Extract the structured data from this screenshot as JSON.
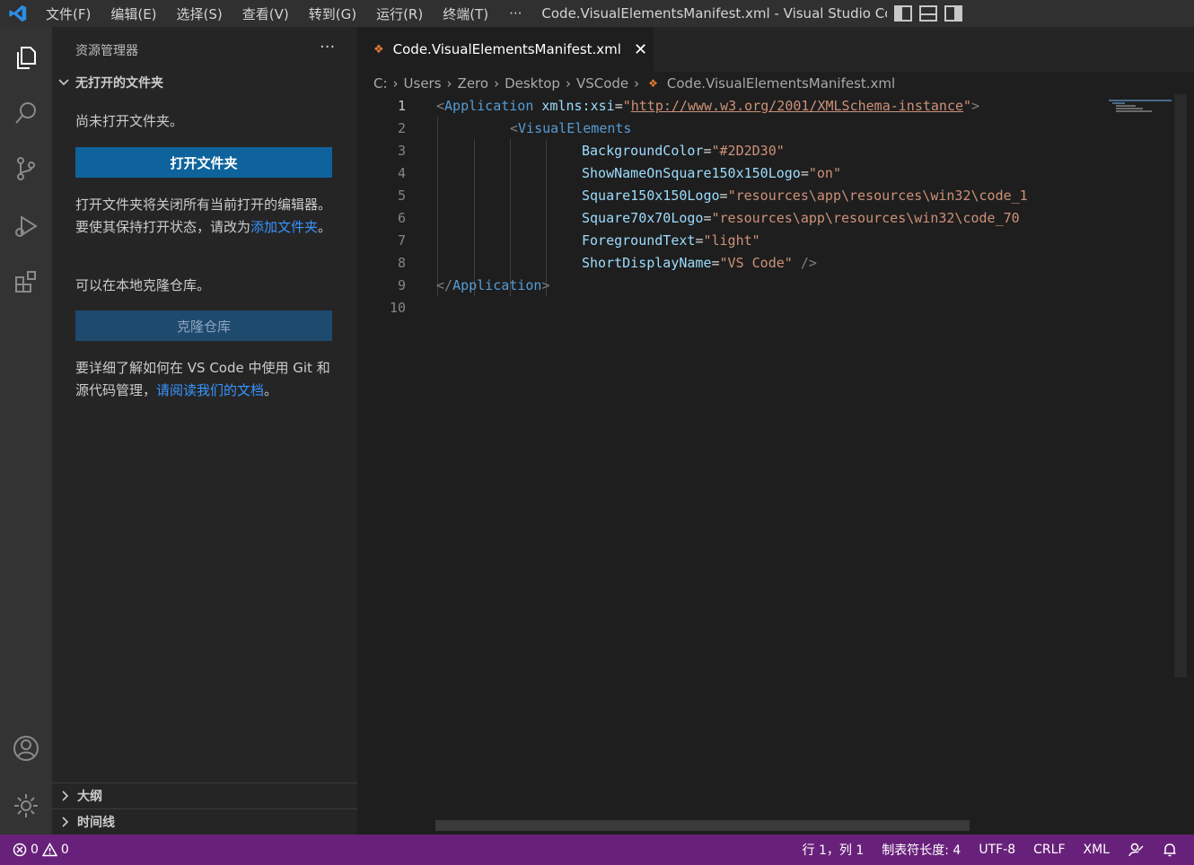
{
  "titlebar": {
    "menus": [
      "文件(F)",
      "编辑(E)",
      "选择(S)",
      "查看(V)",
      "转到(G)",
      "运行(R)",
      "终端(T)"
    ],
    "more": "···",
    "window_title": "Code.VisualElementsManifest.xml - Visual Studio Cod..."
  },
  "sidebar": {
    "header": "资源管理器",
    "header_more": "···",
    "section_title": "无打开的文件夹",
    "no_folder_text": "尚未打开文件夹。",
    "open_folder_button": "打开文件夹",
    "open_folder_note_1": "打开文件夹将关闭所有当前打开的编辑器。要使其保持打开状态，请改为",
    "open_folder_note_link": "添加文件夹",
    "open_folder_note_end": "。",
    "clone_text": "可以在本地克隆仓库。",
    "clone_button": "克隆仓库",
    "learn_text": "要详细了解如何在 VS Code 中使用 Git 和源代码管理，",
    "learn_link": "请阅读我们的文档",
    "learn_end": "。",
    "outline": "大纲",
    "timeline": "时间线"
  },
  "editor": {
    "tab_label": "Code.VisualElementsManifest.xml",
    "breadcrumb": [
      "C:",
      "Users",
      "Zero",
      "Desktop",
      "VSCode",
      "Code.VisualElementsManifest.xml"
    ],
    "line_numbers": [
      "1",
      "2",
      "3",
      "4",
      "5",
      "6",
      "7",
      "8",
      "9",
      "10"
    ],
    "line1": {
      "open": "<",
      "tag": "Application",
      "attr": "xmlns:xsi",
      "eq": "=",
      "q1": "\"",
      "url": "http://www.w3.org/2001/XMLSchema-instance",
      "q2": "\"",
      "close": ">"
    },
    "line2": {
      "open": "<",
      "tag": "VisualElements"
    },
    "line3": {
      "attr": "BackgroundColor",
      "eq": "=",
      "val": "\"#2D2D30\""
    },
    "line4": {
      "attr": "ShowNameOnSquare150x150Logo",
      "eq": "=",
      "val": "\"on\""
    },
    "line5": {
      "attr": "Square150x150Logo",
      "eq": "=",
      "val": "\"resources\\app\\resources\\win32\\code_1"
    },
    "line6": {
      "attr": "Square70x70Logo",
      "eq": "=",
      "val": "\"resources\\app\\resources\\win32\\code_70"
    },
    "line7": {
      "attr": "ForegroundText",
      "eq": "=",
      "val": "\"light\""
    },
    "line8": {
      "attr": "ShortDisplayName",
      "eq": "=",
      "val": "\"VS Code\"",
      "close": " />"
    },
    "line9": {
      "open": "</",
      "tag": "Application",
      "close": ">"
    }
  },
  "statusbar": {
    "errors": "0",
    "warnings": "0",
    "position": "行 1，列 1",
    "tab_size": "制表符长度: 4",
    "encoding": "UTF-8",
    "eol": "CRLF",
    "language": "XML"
  },
  "colors": {
    "statusbar": "#68217a",
    "button": "#0e639c",
    "accent_link": "#3794ff"
  }
}
